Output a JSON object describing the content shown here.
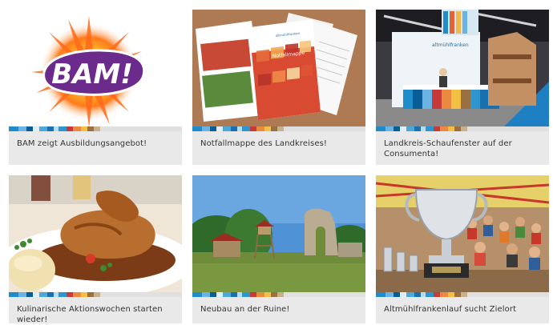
{
  "cards": [
    {
      "title": "BAM zeigt Ausbildungsangebot!",
      "logo_text": "BAM!"
    },
    {
      "title": "Notfallmappe des Landkreises!",
      "folder_label": "Notfallmappe",
      "folder_brand": "altmühlfranken"
    },
    {
      "title": "Landkreis-Schaufenster auf der Consumenta!",
      "booth_brand": "altmühlfranken"
    },
    {
      "title": "Kulinarische Aktionswochen starten wieder!"
    },
    {
      "title": "Neubau an der Ruine!"
    },
    {
      "title": "Altmühlfrankenlauf sucht Zielort"
    }
  ],
  "colors": {
    "card_bg": "#e9e9e9",
    "text": "#333333",
    "accent_blue": "#1f8dc9",
    "bam_purple": "#6a2b8d"
  }
}
